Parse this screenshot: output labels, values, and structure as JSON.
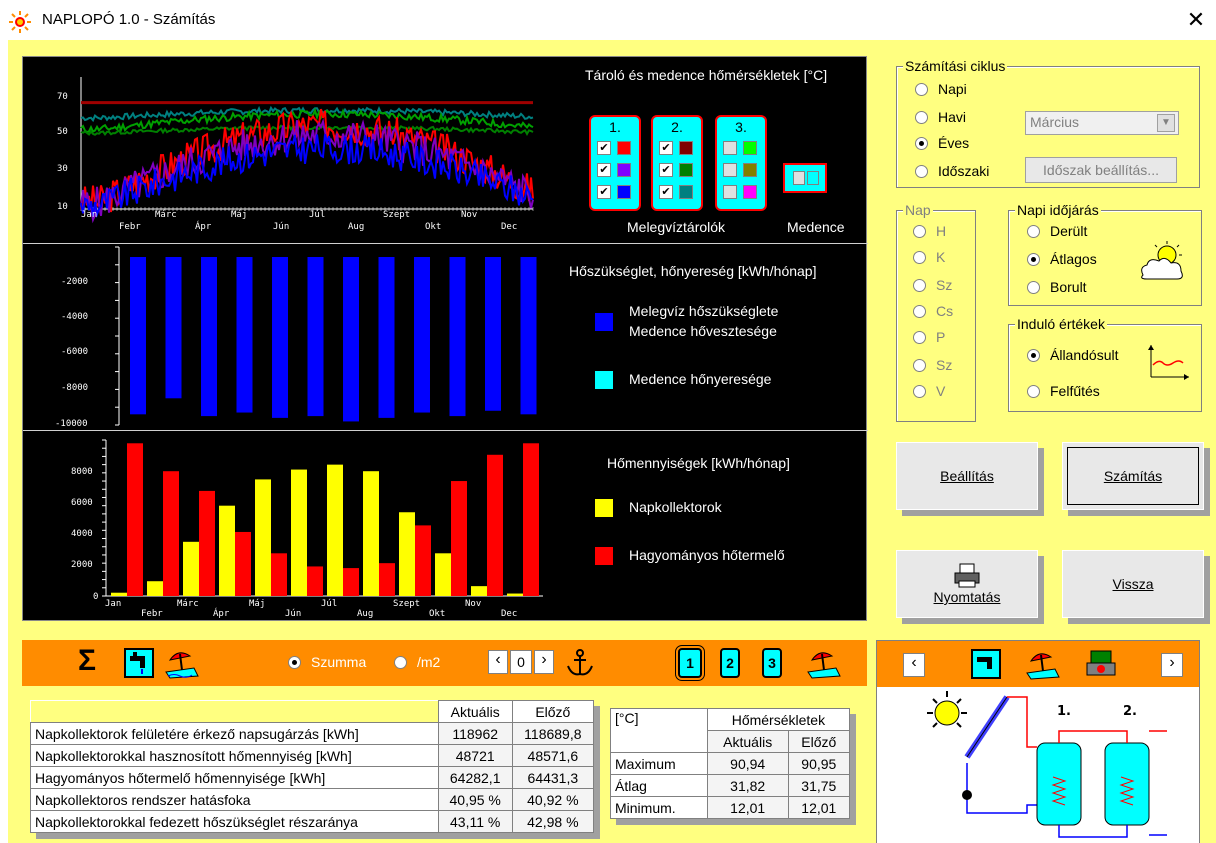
{
  "window": {
    "title": "NAPLOPÓ 1.0  -  Számítás",
    "close": "✕"
  },
  "chart1": {
    "title": "Tároló és medence hőmérsékletek [°C]",
    "yticks": [
      "70",
      "50",
      "30",
      "10"
    ],
    "months_top": [
      "Jan",
      "Márc",
      "Máj",
      "Júl",
      "Szept",
      "Nov"
    ],
    "months_bottom": [
      "Febr",
      "Ápr",
      "Jún",
      "Aug",
      "Okt",
      "Dec"
    ]
  },
  "tanks": {
    "label": "Melegvíztárolók",
    "pool_label": "Medence",
    "t1": "1.",
    "t2": "2.",
    "t3": "3.",
    "colors1": [
      "#ff0000",
      "#8000ff",
      "#0000ff"
    ],
    "colors2": [
      "#800000",
      "#008000",
      "#008080"
    ],
    "colors3": [
      "#00ff00",
      "#808000",
      "#ff00ff"
    ],
    "pool_color": "#00ffff"
  },
  "chart2": {
    "title": "Hőszükséglet, hőnyereség [kWh/hónap]",
    "yticks": [
      "-2000",
      "-4000",
      "-6000",
      "-8000",
      "-10000"
    ],
    "legend1": "Melegvíz hőszükséglete",
    "legend1b": "Medence hővesztesége",
    "legend2": "Medence hőnyeresége"
  },
  "chart3": {
    "title": "Hőmennyiségek [kWh/hónap]",
    "yticks": [
      "8000",
      "6000",
      "4000",
      "2000",
      "0"
    ],
    "legend1": "Napkollektorok",
    "legend2": "Hagyományos hőtermelő",
    "months_top": [
      "Jan",
      "Márc",
      "Máj",
      "Júl",
      "Szept",
      "Nov"
    ],
    "months_bottom": [
      "Febr",
      "Ápr",
      "Jún",
      "Aug",
      "Okt",
      "Dec"
    ]
  },
  "chart_data": [
    {
      "type": "bar",
      "categories": [
        "Jan",
        "Febr",
        "Márc",
        "Ápr",
        "Máj",
        "Jún",
        "Júl",
        "Aug",
        "Szept",
        "Okt",
        "Nov",
        "Dec"
      ],
      "series": [
        {
          "name": "Melegvíz hőszükséglete",
          "values": [
            -9400,
            -8500,
            -9500,
            -9300,
            -9600,
            -9500,
            -9800,
            -9600,
            -9300,
            -9500,
            -9200,
            -9400
          ]
        }
      ],
      "ylim": [
        -10000,
        0
      ],
      "title": "Hőszükséglet, hőnyereség [kWh/hónap]"
    },
    {
      "type": "bar",
      "categories": [
        "Jan",
        "Febr",
        "Márc",
        "Ápr",
        "Máj",
        "Jún",
        "Júl",
        "Aug",
        "Szept",
        "Okt",
        "Nov",
        "Dec"
      ],
      "series": [
        {
          "name": "Napkollektorok",
          "values": [
            200,
            900,
            3300,
            5500,
            7100,
            7700,
            8000,
            7600,
            5100,
            2600,
            600,
            150
          ]
        },
        {
          "name": "Hagyományos hőtermelő",
          "values": [
            9300,
            7600,
            6400,
            3900,
            2600,
            1800,
            1700,
            2000,
            4300,
            7000,
            8600,
            9300
          ]
        }
      ],
      "ylim": [
        0,
        9500
      ],
      "title": "Hőmennyiségek [kWh/hónap]"
    }
  ],
  "cycle": {
    "label": "Számítási ciklus",
    "opts": [
      "Napi",
      "Havi",
      "Éves",
      "Időszaki"
    ],
    "month": "Március",
    "period_btn": "Időszak beállítás..."
  },
  "day": {
    "label": "Nap",
    "opts": [
      "H",
      "K",
      "Sz",
      "Cs",
      "P",
      "Sz",
      "V"
    ]
  },
  "weather": {
    "label": "Napi időjárás",
    "opts": [
      "Derült",
      "Átlagos",
      "Borult"
    ]
  },
  "init": {
    "label": "Induló értékek",
    "opts": [
      "Állandósult",
      "Felfűtés"
    ]
  },
  "buttons": {
    "settings": "Beállítás",
    "calc": "Számítás",
    "print": "Nyomtatás",
    "back": "Vissza"
  },
  "toolbar": {
    "sigma": "Σ",
    "szumma": "Szumma",
    "m2": "/m2",
    "counter": "0",
    "t1": "1",
    "t2": "2",
    "t3": "3"
  },
  "results": {
    "h_act": "Aktuális",
    "h_prev": "Előző",
    "rows": [
      {
        "label": "Napkollektorok felületére érkező napsugárzás [kWh]",
        "act": "118962",
        "prev": "118689,8"
      },
      {
        "label": "Napkollektorokkal hasznosított hőmennyiség [kWh]",
        "act": "48721",
        "prev": "48571,6"
      },
      {
        "label": "Hagyományos hőtermelő hőmennyisége [kWh]",
        "act": "64282,1",
        "prev": "64431,3"
      },
      {
        "label": "Napkollektoros rendszer hatásfoka",
        "act": "40,95 %",
        "prev": "40,92 %"
      },
      {
        "label": "Napkollektorokkal fedezett hőszükséglet részaránya",
        "act": "43,11 %",
        "prev": "42,98 %"
      }
    ]
  },
  "temps": {
    "unit": "[°C]",
    "title": "Hőmérsékletek",
    "h_act": "Aktuális",
    "h_prev": "Előző",
    "rows": [
      {
        "label": "Maximum",
        "act": "90,94",
        "prev": "90,95"
      },
      {
        "label": "Átlag",
        "act": "31,82",
        "prev": "31,75"
      },
      {
        "label": "Minimum.",
        "act": "12,01",
        "prev": "12,01"
      }
    ]
  },
  "schematic": {
    "t1": "1.",
    "t2": "2."
  }
}
